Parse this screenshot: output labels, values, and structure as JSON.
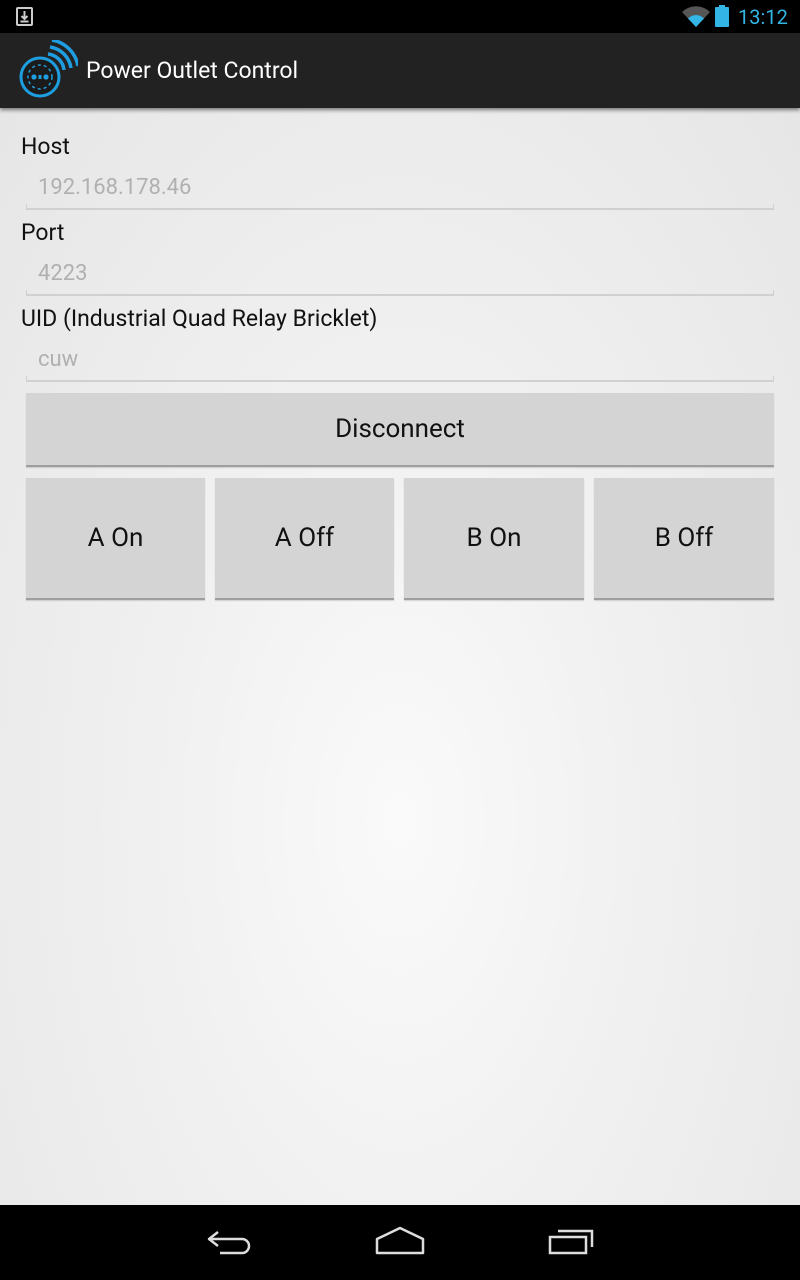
{
  "status_bar": {
    "time": "13:12",
    "icons": [
      "download-notification-icon",
      "wifi-icon",
      "battery-icon"
    ],
    "accent_color": "#33b5e5"
  },
  "action_bar": {
    "title": "Power Outlet Control",
    "icon": "power-outlet-wifi-icon"
  },
  "form": {
    "host": {
      "label": "Host",
      "value": "192.168.178.46"
    },
    "port": {
      "label": "Port",
      "value": "4223"
    },
    "uid": {
      "label": "UID (Industrial Quad Relay Bricklet)",
      "value": "cuw"
    }
  },
  "buttons": {
    "connect": "Disconnect",
    "a_on": "A On",
    "a_off": "A Off",
    "b_on": "B On",
    "b_off": "B Off"
  },
  "nav_bar": {
    "icons": [
      "back-icon",
      "home-icon",
      "recent-apps-icon"
    ]
  }
}
